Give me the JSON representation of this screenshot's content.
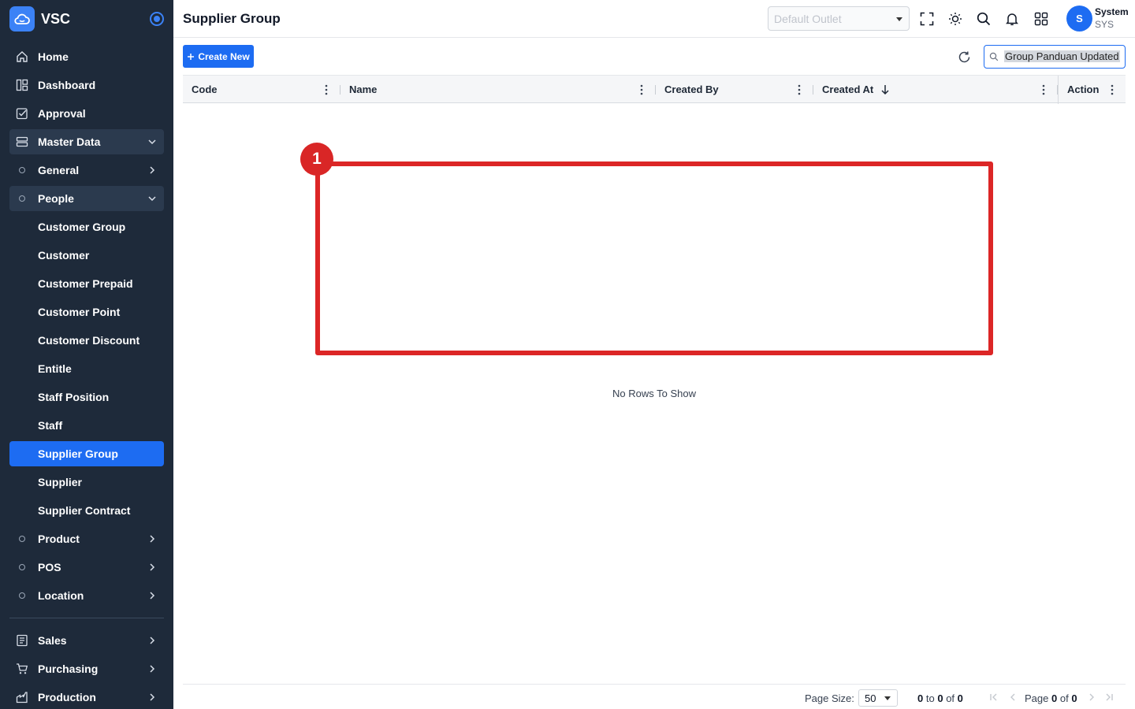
{
  "brand": {
    "name": "VSC"
  },
  "sidebar": {
    "items": [
      {
        "label": "Home",
        "icon": "home-icon"
      },
      {
        "label": "Dashboard",
        "icon": "dashboard-icon"
      },
      {
        "label": "Approval",
        "icon": "approval-icon"
      },
      {
        "label": "Master Data",
        "icon": "database-icon",
        "expanded": true
      },
      {
        "label": "General",
        "icon": "circle-icon"
      },
      {
        "label": "People",
        "icon": "circle-icon",
        "expanded": true
      },
      {
        "label": "Customer Group"
      },
      {
        "label": "Customer"
      },
      {
        "label": "Customer Prepaid"
      },
      {
        "label": "Customer Point"
      },
      {
        "label": "Customer Discount"
      },
      {
        "label": "Entitle"
      },
      {
        "label": "Staff Position"
      },
      {
        "label": "Staff"
      },
      {
        "label": "Supplier Group",
        "active": true
      },
      {
        "label": "Supplier"
      },
      {
        "label": "Supplier Contract"
      },
      {
        "label": "Product",
        "icon": "circle-icon"
      },
      {
        "label": "POS",
        "icon": "circle-icon"
      },
      {
        "label": "Location",
        "icon": "circle-icon"
      },
      {
        "label": "Sales",
        "icon": "sales-icon"
      },
      {
        "label": "Purchasing",
        "icon": "cart-icon"
      },
      {
        "label": "Production",
        "icon": "factory-icon"
      }
    ]
  },
  "header": {
    "title": "Supplier Group",
    "outlet_placeholder": "Default Outlet",
    "user": {
      "initial": "S",
      "name": "System",
      "code": "SYS"
    }
  },
  "toolbar": {
    "create_label": "Create New",
    "search_value": "Group Panduan Updated"
  },
  "grid": {
    "columns": [
      "Code",
      "Name",
      "Created By",
      "Created At",
      "Action"
    ],
    "sort": {
      "column": "Created At",
      "direction": "desc"
    },
    "empty_message": "No Rows To Show"
  },
  "annotation": {
    "badge": "1"
  },
  "pagination": {
    "page_size_label": "Page Size:",
    "page_size": "50",
    "range_from": "0",
    "range_to_word": "to",
    "range_to": "0",
    "range_of_word": "of",
    "range_total": "0",
    "page_word": "Page",
    "page_current": "0",
    "page_of_word": "of",
    "page_total": "0"
  },
  "colors": {
    "sidebar_bg": "#1e2a3a",
    "accent": "#1d6cf2",
    "highlight": "#dc2626"
  }
}
